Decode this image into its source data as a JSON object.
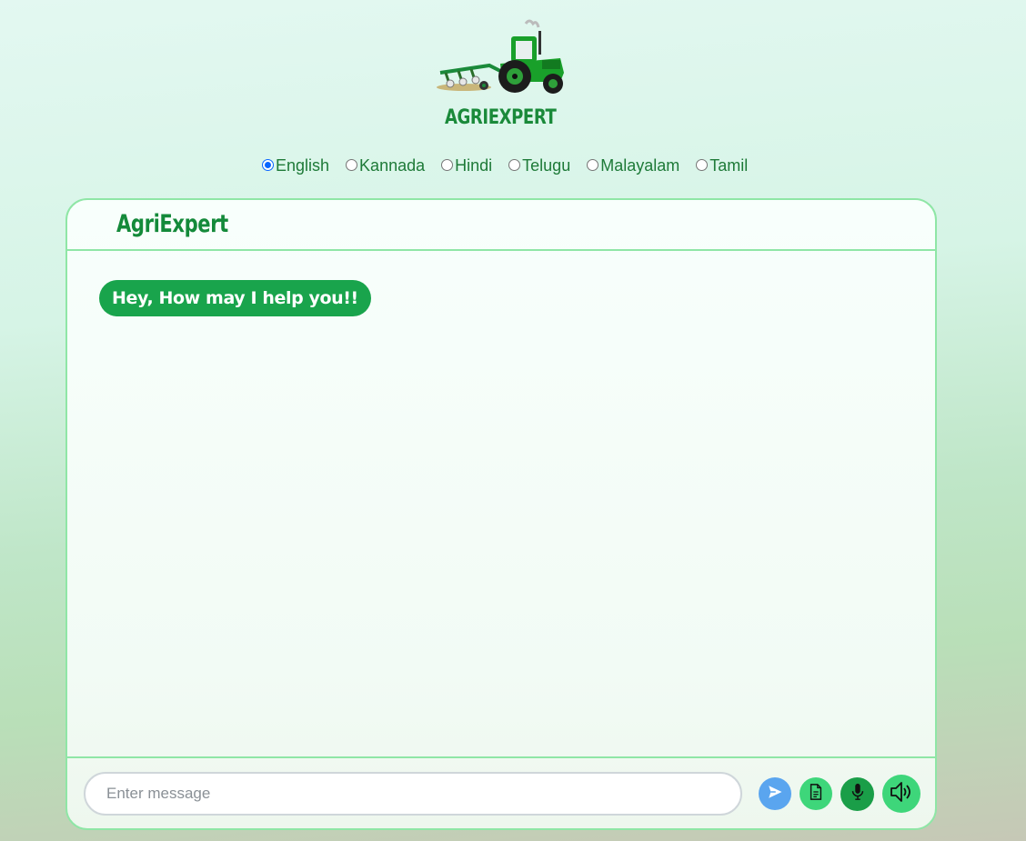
{
  "brand": {
    "logo_icon": "tractor-with-plough-icon",
    "name": "AGRIEXPERT"
  },
  "languages": {
    "selected": "English",
    "options": [
      "English",
      "Kannada",
      "Hindi",
      "Telugu",
      "Malayalam",
      "Tamil"
    ]
  },
  "chat": {
    "title": "AgriExpert",
    "messages": [
      {
        "sender": "bot",
        "text": "Hey, How may I help you!!"
      }
    ],
    "input": {
      "placeholder": "Enter message",
      "value": ""
    },
    "buttons": {
      "send_icon": "send-icon",
      "document_icon": "document-icon",
      "microphone_icon": "microphone-icon",
      "speaker_icon": "speaker-icon"
    }
  },
  "colors": {
    "brand_green": "#1a8a3a",
    "bubble_green": "#19a44c",
    "border_green": "#8fe6a6",
    "send_blue": "#5aa5ef",
    "radio_blue": "#0a66ff"
  }
}
